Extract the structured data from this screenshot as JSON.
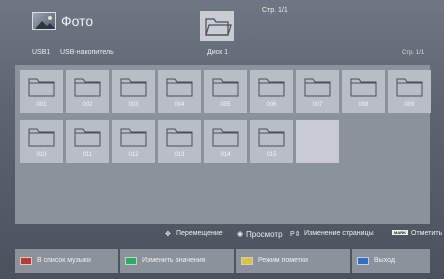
{
  "header": {
    "title": "Фото",
    "page": "Стр. 1/1"
  },
  "breadcrumb": {
    "device": "USB1",
    "storage": "USB-накопитель",
    "disk": "Диск 1",
    "page": "Стр. 1/1"
  },
  "folders": [
    "001",
    "002",
    "003",
    "004",
    "005",
    "006",
    "007",
    "008",
    "009",
    "010",
    "011",
    "012",
    "013",
    "014",
    "015"
  ],
  "nav": {
    "move": "Перемещение",
    "view": "Просмотр",
    "page_change": "Изменение страницы",
    "mark_badge": "MARK",
    "mark": "Отметить"
  },
  "footer": {
    "music": "В список музыки",
    "change": "Изменить значения",
    "mark_mode": "Режим пометки",
    "exit": "Выход"
  },
  "colors": {
    "red": "#c0392b",
    "green": "#27ae60",
    "yellow": "#e3c23a",
    "blue": "#2f6ec9"
  }
}
